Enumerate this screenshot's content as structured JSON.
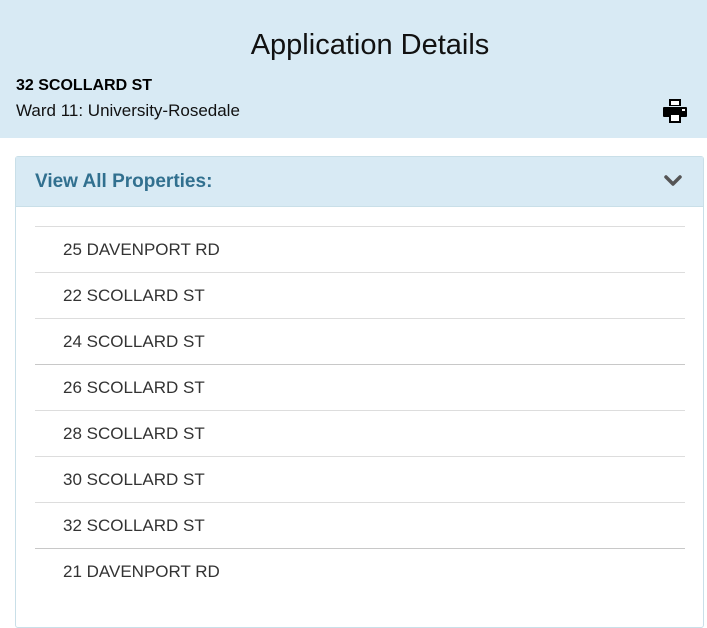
{
  "header": {
    "title": "Application Details",
    "address": "32 SCOLLARD ST",
    "ward": "Ward 11: University-Rosedale",
    "print_icon": "printer-icon"
  },
  "panel": {
    "title": "View All Properties:",
    "toggle_icon": "chevron-down-icon",
    "properties": [
      "25 DAVENPORT RD",
      "22 SCOLLARD ST",
      "24 SCOLLARD ST",
      "26 SCOLLARD ST",
      "28 SCOLLARD ST",
      "30 SCOLLARD ST",
      "32 SCOLLARD ST",
      "21 DAVENPORT RD"
    ]
  },
  "colors": {
    "header_bg": "#d8eaf4",
    "panel_title": "#31708f",
    "divider": "#dddddd"
  }
}
